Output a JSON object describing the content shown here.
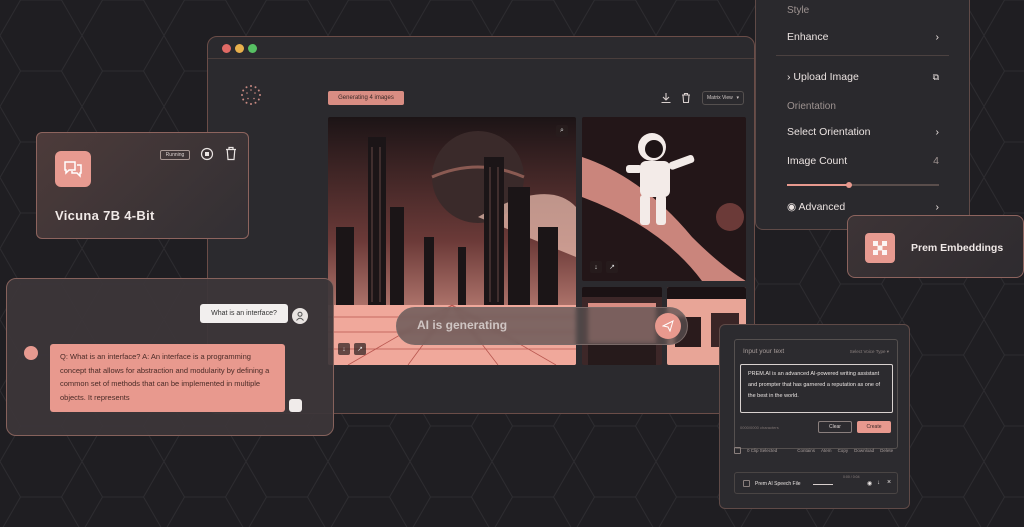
{
  "main_window": {
    "generating_chip": "Generating 4 images",
    "view_select": "Matrix View",
    "prompt_text": "AI is generating",
    "traffic_lights": [
      "#e06a65",
      "#e8b04c",
      "#57c063"
    ]
  },
  "style_panel": {
    "style_label": "Style",
    "enhance": "Enhance",
    "upload_image": "Upload Image",
    "orientation_label": "Orientation",
    "select_orientation": "Select Orientation",
    "image_count_label": "Image Count",
    "image_count_value": "4",
    "advanced": "Advanced"
  },
  "vicuna_card": {
    "status": "Running",
    "title": "Vicuna 7B 4-Bit"
  },
  "chat": {
    "user_message": "What is an interface?",
    "bot_message": "Q: What is an interface? A: An interface is a programming concept that allows for abstraction and modularity by defining a common set of methods that can be implemented in multiple objects. It represents"
  },
  "embeddings_card": {
    "title": "Prem Embeddings"
  },
  "text_panel": {
    "label": "Input your text",
    "select_voice": "Select Voice Type",
    "text": "PREM.AI is an advanced AI-powered writing assistant and prompter that has garnered a reputation as one of the best in the world.",
    "char_count": "0000/0000 characters",
    "clear": "Clear",
    "create": "Create",
    "clip_selected": "0 Clip Selected",
    "col1": "Contains",
    "col2": "Atem",
    "col3": "Copy",
    "col4": "Download",
    "col5": "Delete",
    "file_name": "Prem AI Speech File",
    "file_time": "0:00 / 0:04"
  },
  "colors": {
    "accent": "#e8998e",
    "background": "#1f1e22",
    "panel": "#2b2a2e"
  }
}
